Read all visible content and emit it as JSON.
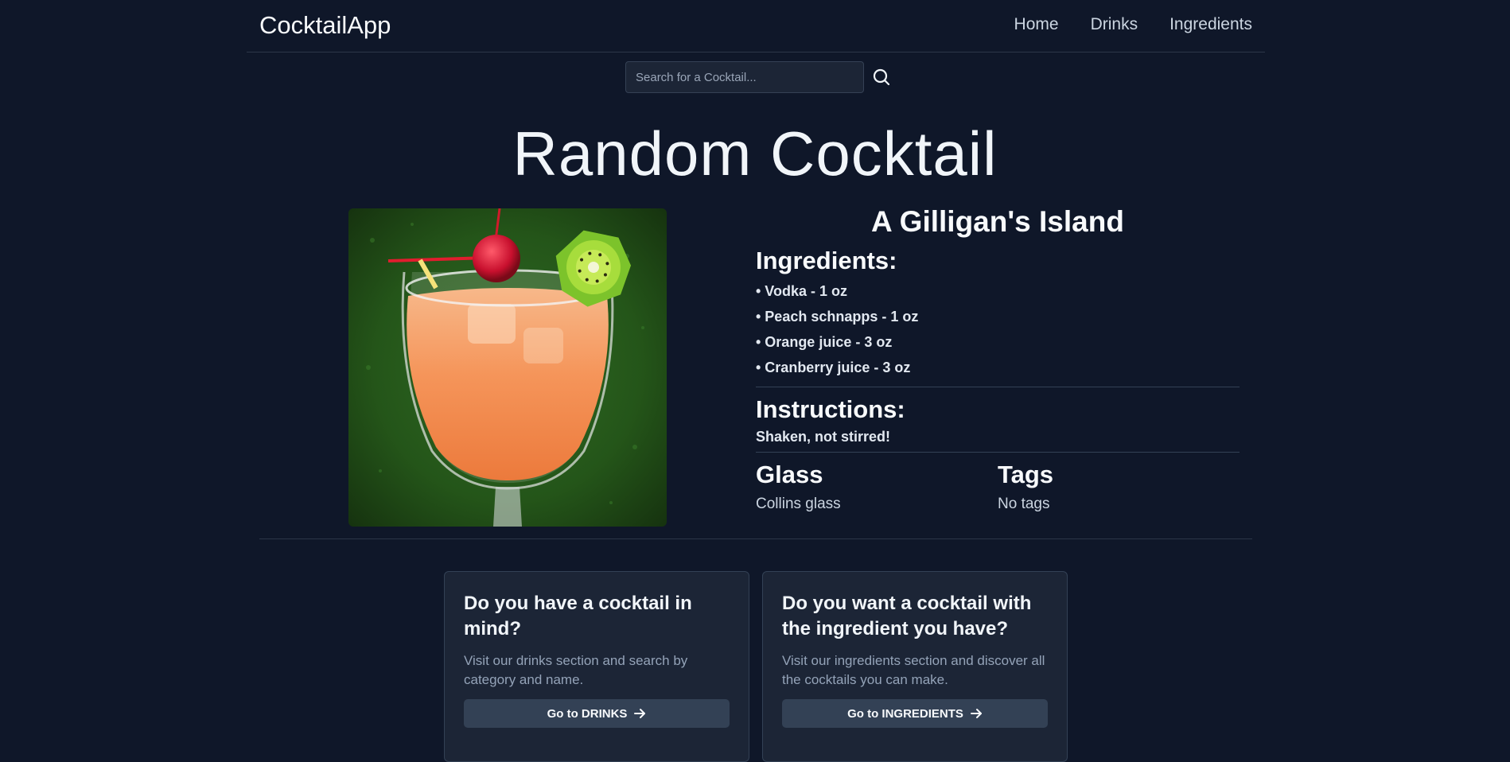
{
  "header": {
    "brand": "CocktailApp",
    "nav": [
      {
        "label": "Home"
      },
      {
        "label": "Drinks"
      },
      {
        "label": "Ingredients"
      }
    ]
  },
  "search": {
    "placeholder": "Search for a Cocktail...",
    "value": "",
    "icon": "search-icon"
  },
  "page": {
    "title": "Random Cocktail"
  },
  "drink": {
    "name": "A Gilligan's Island",
    "ingredients_heading": "Ingredients:",
    "ingredients": [
      "• Vodka - 1 oz",
      "• Peach schnapps - 1 oz",
      "• Orange juice - 3 oz",
      "• Cranberry juice - 3 oz"
    ],
    "instructions_heading": "Instructions:",
    "instructions": "Shaken, not stirred!",
    "glass_heading": "Glass",
    "glass": "Collins glass",
    "tags_heading": "Tags",
    "tags": "No tags"
  },
  "cards": [
    {
      "title": "Do you have a cocktail in mind?",
      "text": "Visit our drinks section and search by category and name.",
      "button": "Go to DRINKS",
      "icon": "arrow-right-icon"
    },
    {
      "title": "Do you want a cocktail with the ingredient you have?",
      "text": "Visit our ingredients section and discover all the cocktails you can make.",
      "button": "Go to INGREDIENTS",
      "icon": "arrow-right-icon"
    }
  ],
  "colors": {
    "background": "#0f1729",
    "card": "#1c2536",
    "button": "#334155"
  }
}
